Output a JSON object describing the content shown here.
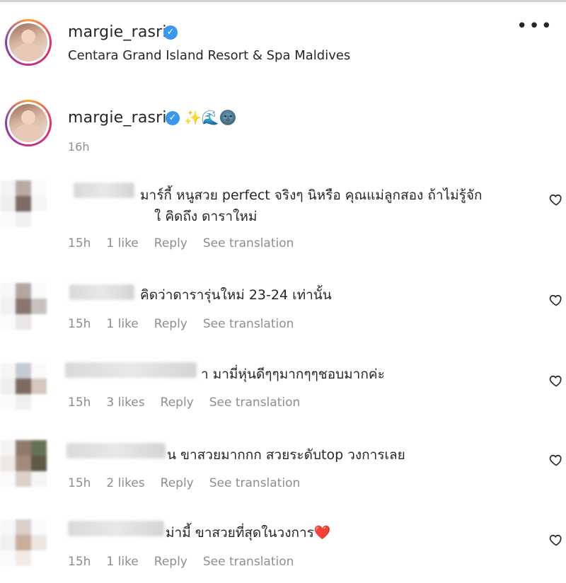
{
  "post": {
    "username": "margie_rasri",
    "location": "Centara Grand Island Resort & Spa Maldives",
    "more_label": "•••"
  },
  "caption": {
    "username": "margie_rasri",
    "emojis": "✨🌊🌚",
    "time": "16h"
  },
  "comments": [
    {
      "text_line1": "มาร์กี้ หนูสวย perfect จริงๆ นิหรือ คุณแม่ลูกสอง ถ้าไม่รู้จัก",
      "text_line2": "ใ คิดถึง ดาราใหม่",
      "time": "15h",
      "likes": "1 like",
      "reply": "Reply",
      "translate": "See translation"
    },
    {
      "text_line1": "คิดว่าดารารุ่นใหม่ 23-24 เท่านั้น",
      "time": "15h",
      "likes": "1 like",
      "reply": "Reply",
      "translate": "See translation"
    },
    {
      "text_line1": "า มามี่หุ่นดีๆๆมากๆๆชอบมากค่ะ",
      "time": "15h",
      "likes": "3 likes",
      "reply": "Reply",
      "translate": "See translation"
    },
    {
      "text_line1": "น ขาสวยมากกก สวยระดับtop วงการเลย",
      "time": "15h",
      "likes": "2 likes",
      "reply": "Reply",
      "translate": "See translation"
    },
    {
      "text_line1": "ม่ามี้ ขาสวยที่สุดในวงการ",
      "emoji": "❤️",
      "time": "15h",
      "likes": "1 like",
      "reply": "Reply",
      "translate": "See translation"
    }
  ],
  "colors": {
    "verified": "#3897f0",
    "text": "#262626",
    "muted": "#8e8e8e",
    "heart_emoji": "#e0245e"
  }
}
